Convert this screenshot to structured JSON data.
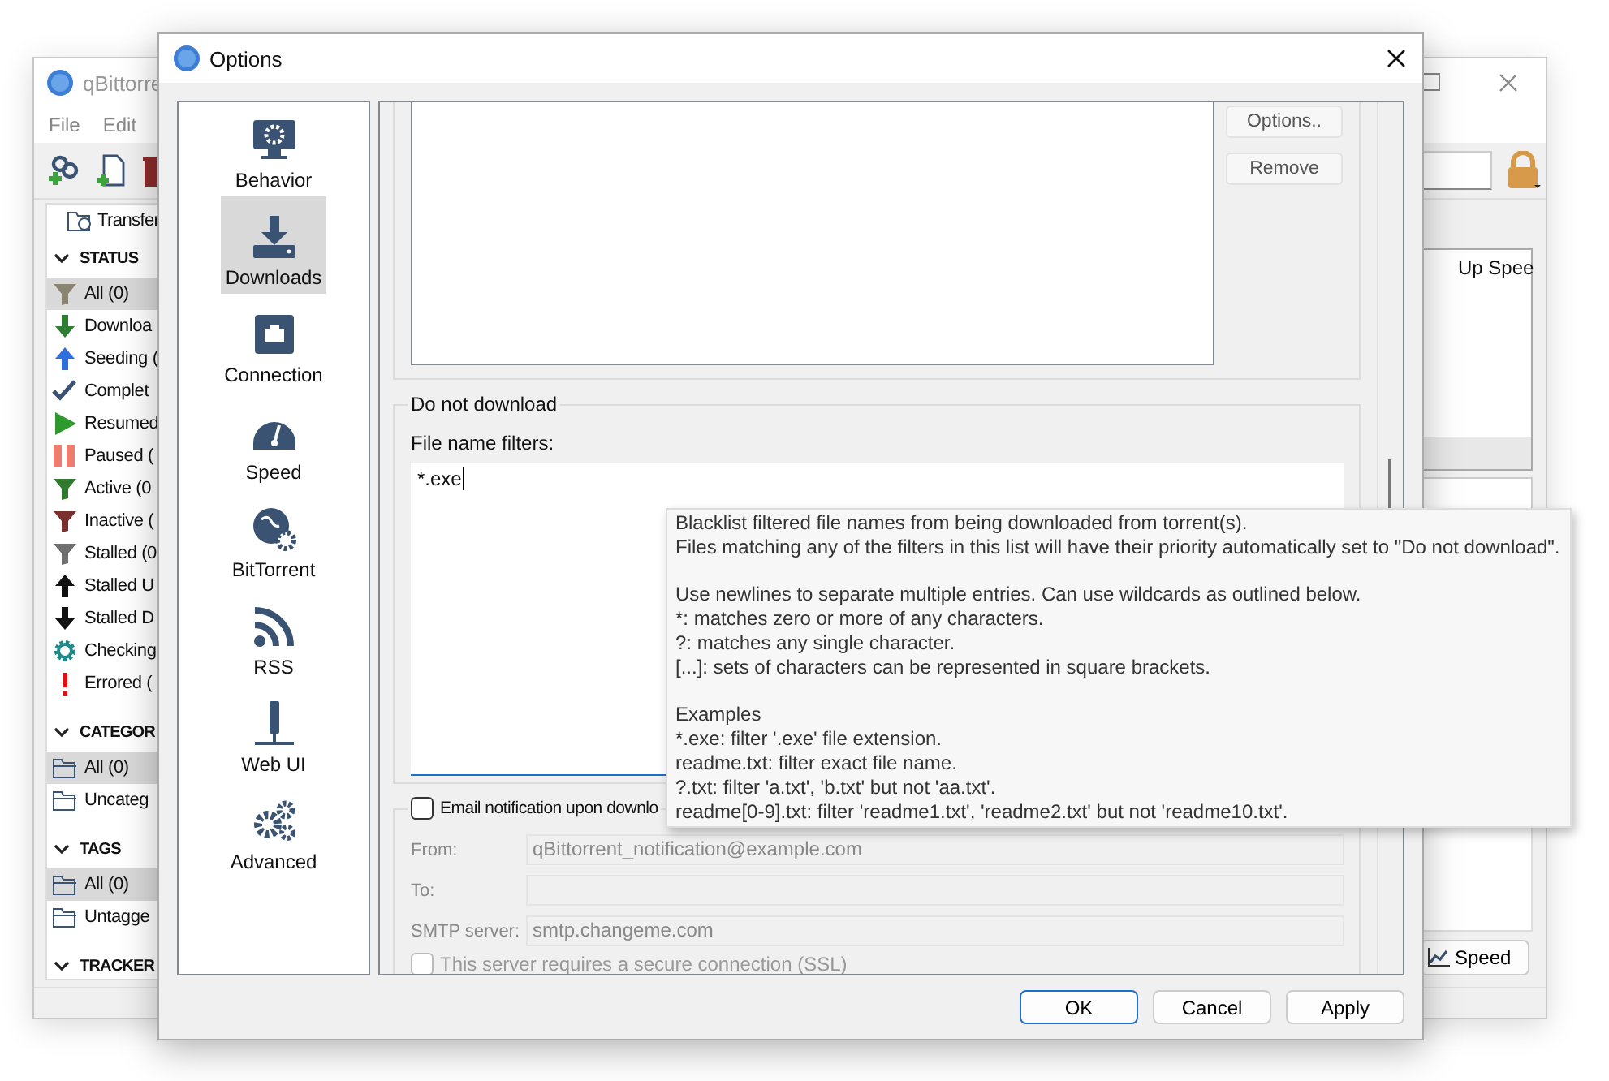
{
  "main_window": {
    "title": "qBittorre",
    "menu": [
      {
        "label": "File"
      },
      {
        "label": "Edit"
      }
    ],
    "transfers_label": "Transfer",
    "sections": [
      {
        "title": "STATUS",
        "kind": "status",
        "expanded": true,
        "items": [
          {
            "label": "All (0)",
            "selected": true
          },
          {
            "label": "Downloa",
            "selected": false
          },
          {
            "label": "Seeding (",
            "selected": false
          },
          {
            "label": "Complet",
            "selected": false
          },
          {
            "label": "Resumed",
            "selected": false
          },
          {
            "label": "Paused (",
            "selected": false
          },
          {
            "label": "Active (0",
            "selected": false
          },
          {
            "label": "Inactive (",
            "selected": false
          },
          {
            "label": "Stalled (0",
            "selected": false
          },
          {
            "label": "Stalled U",
            "selected": false
          },
          {
            "label": "Stalled D",
            "selected": false
          },
          {
            "label": "Checking",
            "selected": false
          },
          {
            "label": "Errored (",
            "selected": false
          }
        ]
      },
      {
        "title": "CATEGOR",
        "kind": "folders",
        "expanded": true,
        "items": [
          {
            "label": "All (0)",
            "selected": true
          },
          {
            "label": "Uncateg",
            "selected": false
          }
        ]
      },
      {
        "title": "TAGS",
        "kind": "folders",
        "expanded": true,
        "items": [
          {
            "label": "All (0)",
            "selected": true
          },
          {
            "label": "Untagge",
            "selected": false
          }
        ]
      },
      {
        "title": "TRACKER",
        "expanded": true
      }
    ],
    "table": {
      "columns": [
        {
          "label": "Up Spee"
        }
      ]
    },
    "speed_button": "Speed"
  },
  "options_dialog": {
    "title": "Options",
    "nav": [
      {
        "label": "Behavior",
        "selected": false
      },
      {
        "label": "Downloads",
        "selected": true
      },
      {
        "label": "Connection",
        "selected": false
      },
      {
        "label": "Speed",
        "selected": false
      },
      {
        "label": "BitTorrent",
        "selected": false
      },
      {
        "label": "RSS",
        "selected": false
      },
      {
        "label": "Web UI",
        "selected": false
      },
      {
        "label": "Advanced",
        "selected": false
      }
    ],
    "list_buttons": [
      {
        "label": "Options.."
      },
      {
        "label": "Remove"
      }
    ],
    "do_not_download": {
      "title": "Do not download",
      "filter_label": "File name filters:",
      "filter_value": "*.exe"
    },
    "email": {
      "checkbox": {
        "label": "Email notification upon downlo",
        "checked": false
      },
      "fields": [
        {
          "label": "From:",
          "value": "qBittorrent_notification@example.com",
          "disabled": true
        },
        {
          "label": "To:",
          "disabled": true
        },
        {
          "label": "SMTP server:",
          "value": "smtp.changeme.com",
          "disabled": true
        }
      ],
      "ssl": {
        "label": "This server requires a secure connection (SSL)",
        "checked": false
      }
    },
    "buttons": [
      {
        "label": "OK",
        "default": true
      },
      {
        "label": "Cancel",
        "default": false
      },
      {
        "label": "Apply",
        "default": false
      }
    ]
  },
  "tooltip": {
    "paragraphs": [
      [
        "Blacklist filtered file names from being downloaded from torrent(s).",
        "Files matching any of the filters in this list will have their priority automatically set to \"Do not download\"."
      ],
      [
        "Use newlines to separate multiple entries. Can use wildcards as outlined below.",
        "*: matches zero or more of any characters.",
        "?: matches any single character.",
        "[...]: sets of characters can be represented in square brackets."
      ],
      [
        "Examples",
        "*.exe: filter '.exe' file extension.",
        "readme.txt: filter exact file name.",
        "?.txt: filter 'a.txt', 'b.txt' but not 'aa.txt'.",
        "readme[0-9].txt: filter 'readme1.txt', 'readme2.txt' but not 'readme10.txt'."
      ]
    ]
  }
}
